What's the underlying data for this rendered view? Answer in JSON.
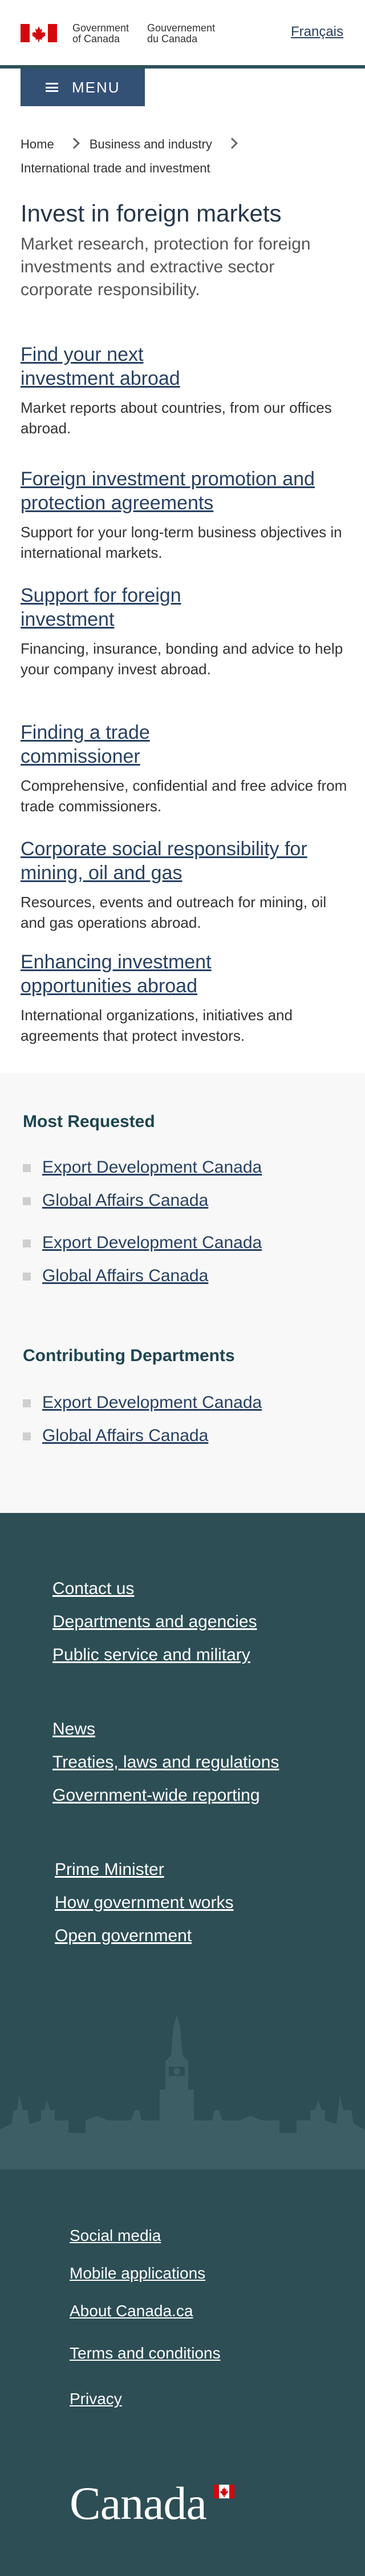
{
  "header": {
    "signature_en": [
      "Government",
      "of Canada"
    ],
    "signature_fr": [
      "Gouvernement",
      "du Canada"
    ],
    "language_toggle": "Français",
    "menu_label": "MENU",
    "colors": {
      "flag_red": "#d3080c",
      "rule": "#2e5258",
      "menu_bg": "#335075"
    }
  },
  "breadcrumb": [
    "Home",
    "Business and industry",
    "International trade and investment"
  ],
  "page": {
    "title": "Invest in foreign markets",
    "lead": "Market research, protection for foreign investments and extractive sector corporate responsibility."
  },
  "topics": [
    {
      "label": "Find your next investment abroad",
      "desc": "Market reports about countries, from our offices abroad."
    },
    {
      "label": "Foreign investment promotion and protection agreements",
      "desc": "Support for your long-term business objectives in international markets."
    },
    {
      "label": "Support for foreign investment",
      "desc": "Financing, insurance, bonding and advice to help your company invest abroad."
    },
    {
      "label": "Finding a trade commissioner",
      "desc": "Comprehensive, confidential and free advice from trade commissioners."
    },
    {
      "label": "Corporate social responsibility for mining, oil and gas",
      "desc": "Resources, events and outreach for mining, oil and gas operations abroad."
    },
    {
      "label": "Enhancing investment opportunities abroad",
      "desc": "International organizations, initiatives and agreements that protect investors."
    }
  ],
  "most_requested": {
    "heading": "Most Requested",
    "group1": [
      "Export Development Canada",
      "Global Affairs Canada"
    ],
    "group2": [
      "Export Development Canada",
      "Global Affairs Canada"
    ]
  },
  "contributing": {
    "heading": "Contributing Departments",
    "items": [
      "Export Development Canada",
      "Global Affairs Canada"
    ]
  },
  "footer": {
    "group1": [
      "Contact us",
      "Departments and agencies",
      "Public service and military"
    ],
    "group2": [
      "News",
      "Treaties, laws and regulations",
      "Government-wide reporting"
    ],
    "group3": [
      "Prime Minister",
      "How government works",
      "Open government"
    ],
    "bottom": [
      "Social media",
      "Mobile applications",
      "About Canada.ca",
      "Terms and conditions",
      "Privacy"
    ],
    "wordmark": "Canada",
    "colors": {
      "bg": "#2d4e55",
      "skyline": "#3c5e64"
    }
  }
}
